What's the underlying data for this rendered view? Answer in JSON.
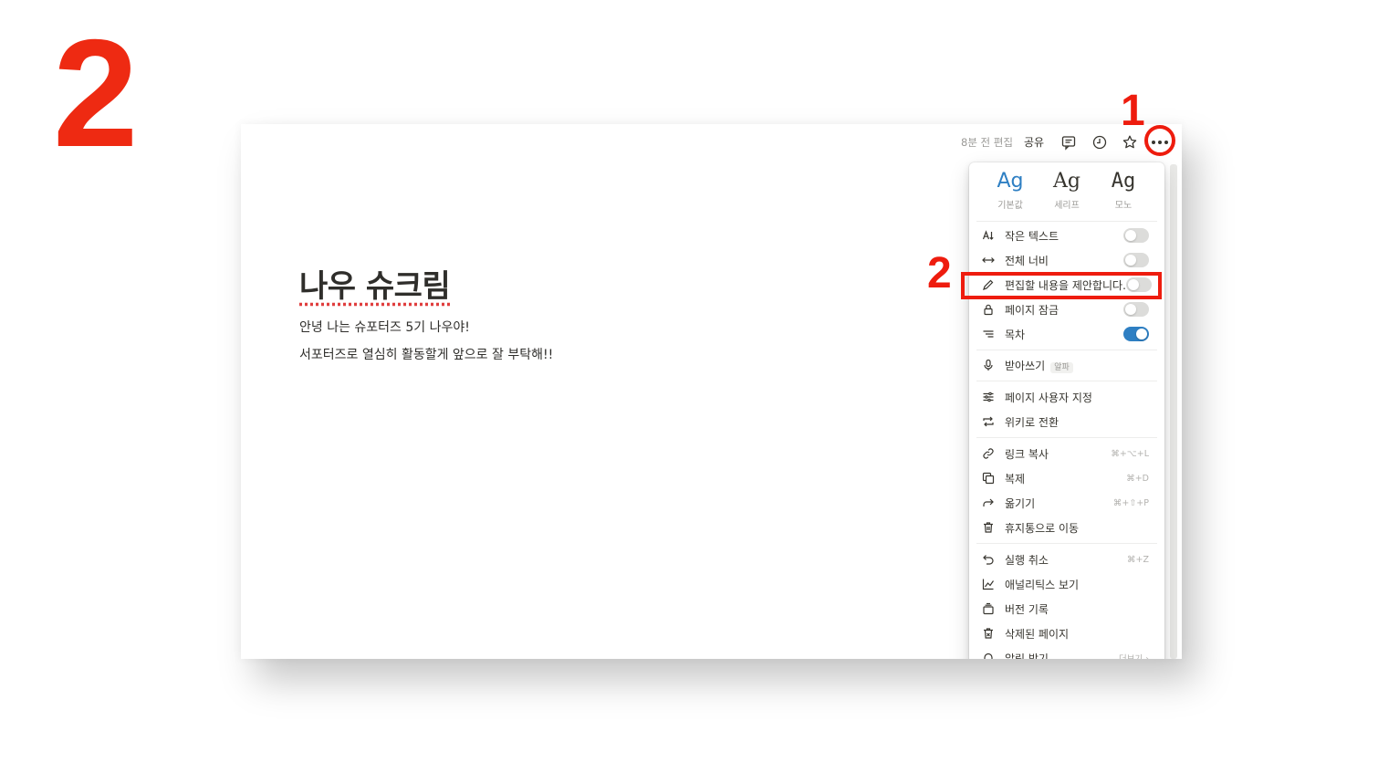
{
  "step_number": "2",
  "callouts": {
    "first": "1",
    "second": "2"
  },
  "topbar": {
    "edited": "8분 전 편집",
    "share": "공유",
    "icons": [
      "comment-icon",
      "history-icon",
      "star-icon",
      "more-icon"
    ]
  },
  "page": {
    "title": "나우 슈크림",
    "lines": [
      "안녕 나는 슈포터즈 5기 나우야!",
      "서포터즈로 열심히 활동할게 앞으로 잘 부탁해!!"
    ]
  },
  "menu": {
    "fonts": [
      {
        "sample": "Ag",
        "label": "기본값"
      },
      {
        "sample": "Ag",
        "label": "세리프"
      },
      {
        "sample": "Ag",
        "label": "모노"
      }
    ],
    "toggles": [
      {
        "label": "작은 텍스트",
        "on": false
      },
      {
        "label": "전체 너비",
        "on": false
      },
      {
        "label": "편집할 내용을 제안합니다.",
        "on": false
      },
      {
        "label": "페이지 잠금",
        "on": false
      },
      {
        "label": "목차",
        "on": true
      }
    ],
    "dictation": {
      "label": "받아쓰기",
      "badge": "알파"
    },
    "customize": {
      "label": "페이지 사용자 지정"
    },
    "wiki": {
      "label": "위키로 전환"
    },
    "copy_link": {
      "label": "링크 복사",
      "shortcut": "⌘+⌥+L"
    },
    "duplicate": {
      "label": "복제",
      "shortcut": "⌘+D"
    },
    "move": {
      "label": "옮기기",
      "shortcut": "⌘+⇧+P"
    },
    "trash": {
      "label": "휴지통으로 이동"
    },
    "undo": {
      "label": "실행 취소",
      "shortcut": "⌘+Z"
    },
    "analytics": {
      "label": "애널리틱스 보기"
    },
    "version": {
      "label": "버전 기록"
    },
    "deleted": {
      "label": "삭제된 페이지"
    },
    "notify": {
      "label": "알림 받기",
      "more": "더보기 ›"
    }
  },
  "colors": {
    "accent_red": "#ee1c0e",
    "toggle_on": "#2e7fc3"
  }
}
